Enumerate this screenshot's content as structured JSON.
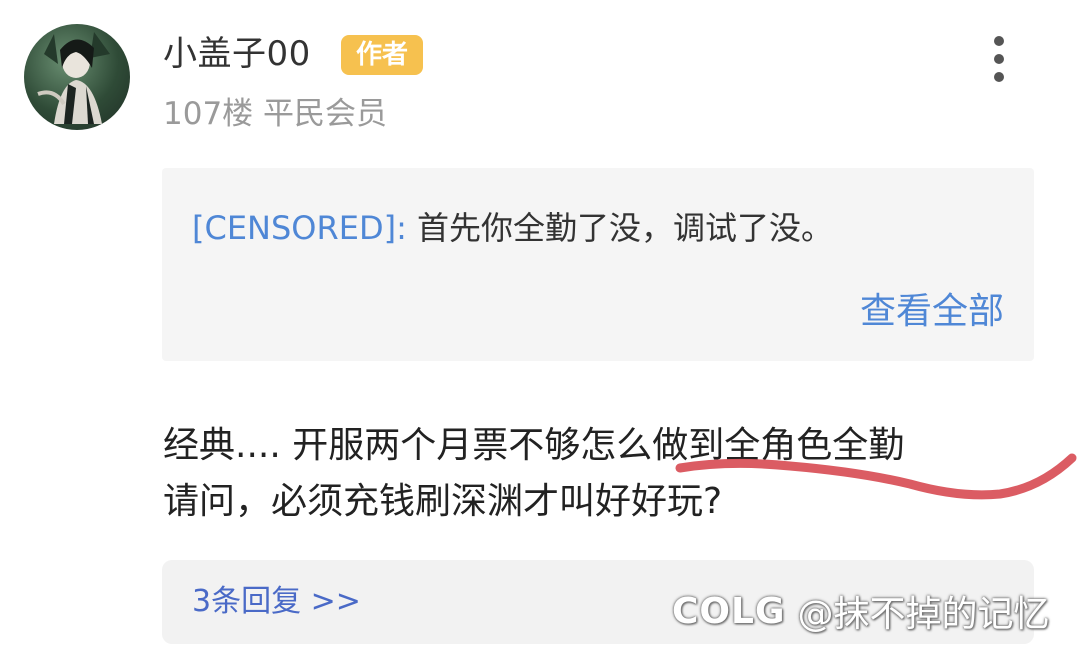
{
  "post": {
    "author": {
      "name": "小盖子00",
      "badge": "作者",
      "floor": "107楼",
      "rank": "平民会员"
    },
    "quote": {
      "name": "[CENSORED]:",
      "text": " 首先你全勤了没，调试了没。",
      "view_all": "查看全部"
    },
    "body": {
      "line1": "经典.... 开服两个月票不够怎么做到全角色全勤",
      "line2": "请问，必须充钱刷深渊才叫好好玩?"
    },
    "replies": {
      "label": "3条回复 >>"
    }
  },
  "watermark": {
    "logo": "COLG",
    "handle": "@抹不掉的记忆"
  },
  "colors": {
    "badge": "#f6c14f",
    "link": "#4f87d6",
    "scribble": "#d9535b"
  },
  "icons": {
    "more": "more-vertical-icon"
  }
}
